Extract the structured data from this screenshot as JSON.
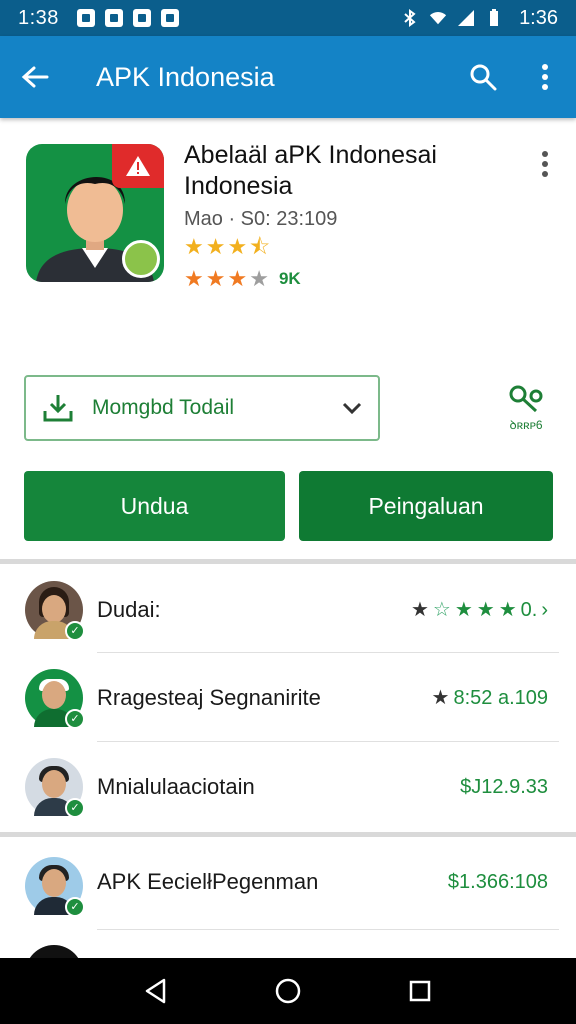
{
  "status_bar": {
    "time_left": "1:38",
    "time_right": "1:36"
  },
  "app_bar": {
    "title": "APK Indonesia"
  },
  "app": {
    "name": "Abelaäl aPK Indonesai Indonesia",
    "meta": "Mao · S0: 23:109",
    "rating_count": "9K",
    "rating_1": 3.5,
    "rating_2": 3.5
  },
  "download": {
    "select_label": "Momgbd Todail",
    "share_label": "ꝺʀʀᴘ6"
  },
  "buttons": {
    "primary": "Undua",
    "secondary": "Peingaluan"
  },
  "list": [
    {
      "title": "Dudai:",
      "right_text": "0.",
      "stars": 5,
      "kind": "stars"
    },
    {
      "title": "Rragesteaj Segnanirite",
      "right_text": "8:52 a.109",
      "kind": "price"
    },
    {
      "title": "Mnialulaaciotain",
      "right_text": "$J12.9.33",
      "kind": "price"
    },
    {
      "title": "APK EecielłPegenman",
      "right_text": "$1.366:108",
      "kind": "price"
    }
  ],
  "colors": {
    "status_bar": "#0b5e8c",
    "app_bar": "#1483c6",
    "accent_green": "#15863b",
    "star_gold": "#f2b01e",
    "star_orange": "#f07a22"
  }
}
